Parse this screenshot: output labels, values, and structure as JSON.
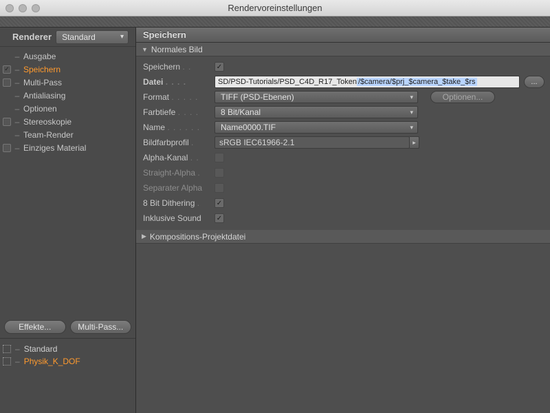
{
  "window": {
    "title": "Rendervoreinstellungen"
  },
  "renderer": {
    "label": "Renderer",
    "value": "Standard"
  },
  "sidebar": {
    "items": [
      {
        "label": "Ausgabe",
        "checkbox": "none"
      },
      {
        "label": "Speichern",
        "checkbox": "checked",
        "active": true
      },
      {
        "label": "Multi-Pass",
        "checkbox": "unchecked"
      },
      {
        "label": "Antialiasing",
        "checkbox": "none"
      },
      {
        "label": "Optionen",
        "checkbox": "none"
      },
      {
        "label": "Stereoskopie",
        "checkbox": "unchecked"
      },
      {
        "label": "Team-Render",
        "checkbox": "none"
      },
      {
        "label": "Einziges Material",
        "checkbox": "unchecked"
      }
    ],
    "buttons": {
      "effects": "Effekte...",
      "multipass": "Multi-Pass..."
    },
    "presets": [
      {
        "label": "Standard"
      },
      {
        "label": "Physik_K_DOF"
      }
    ]
  },
  "panel": {
    "title": "Speichern",
    "section1": "Normales Bild",
    "section2": "Kompositions-Projektdatei",
    "save_label": "Speichern",
    "file_label": "Datei",
    "file_path_prefix": "SD/PSD-Tutorials/PSD_C4D_R17_Token",
    "file_path_selected": "/$camera/$prj_$camera_$take_$rs",
    "browse": "...",
    "format_label": "Format",
    "format_value": "TIFF (PSD-Ebenen)",
    "options_btn": "Optionen...",
    "depth_label": "Farbtiefe",
    "depth_value": "8 Bit/Kanal",
    "name_label": "Name",
    "name_value": "Name0000.TIF",
    "profile_label": "Bildfarbprofil",
    "profile_value": "sRGB IEC61966-2.1",
    "alpha_label": "Alpha-Kanal",
    "straight_label": "Straight-Alpha",
    "separate_label": "Separater Alpha",
    "dither_label": "8 Bit Dithering",
    "sound_label": "Inklusive Sound"
  }
}
